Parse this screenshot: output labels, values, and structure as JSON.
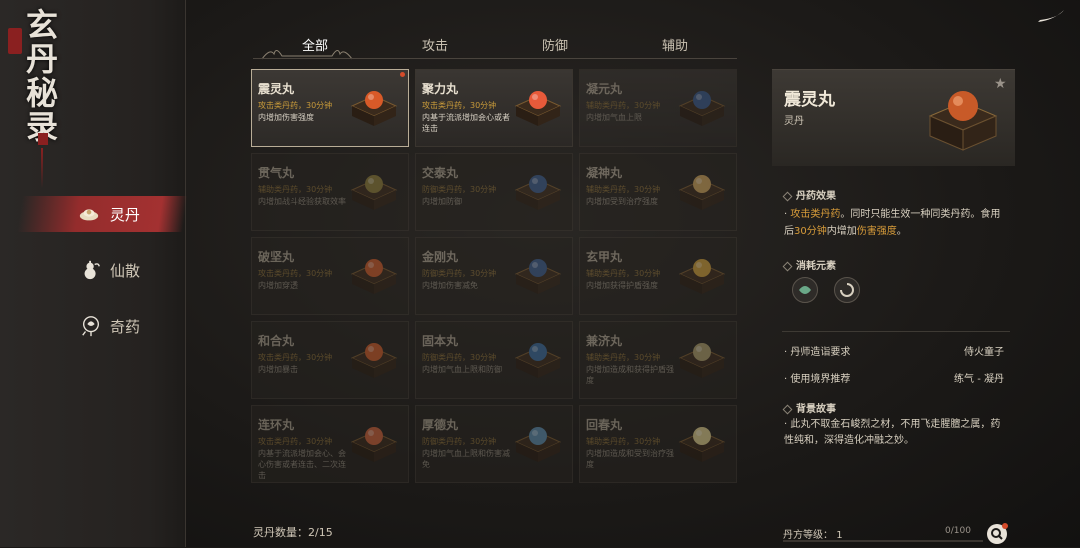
{
  "logo": {
    "chars": [
      "玄",
      "丹",
      "秘",
      "录"
    ]
  },
  "sidebar": {
    "items": [
      {
        "label": "灵丹",
        "icon": "pill-icon",
        "active": true
      },
      {
        "label": "仙散",
        "icon": "gourd-icon",
        "active": false
      },
      {
        "label": "奇药",
        "icon": "herb-icon",
        "active": false
      }
    ]
  },
  "tabs": [
    {
      "label": "全部",
      "active": true
    },
    {
      "label": "攻击",
      "active": false
    },
    {
      "label": "防御",
      "active": false
    },
    {
      "label": "辅助",
      "active": false
    }
  ],
  "pills": [
    {
      "name": "震灵丸",
      "type": "攻击类丹药，30分钟",
      "desc": "内增加伤害强度",
      "selected": true,
      "owned": true,
      "new": true,
      "color": "#d85a28"
    },
    {
      "name": "聚力丸",
      "type": "攻击类丹药，30分钟",
      "desc": "内基于流派增加会心或者连击",
      "selected": false,
      "owned": true,
      "new": false,
      "color": "#e85a3a"
    },
    {
      "name": "凝元丸",
      "type": "辅助类丹药，30分钟",
      "desc": "内增加气血上限",
      "selected": false,
      "owned": false,
      "new": false,
      "color": "#3a5a8a"
    },
    {
      "name": "贯气丸",
      "type": "辅助类丹药，30分钟",
      "desc": "内增加战斗经验获取效率",
      "selected": false,
      "owned": false,
      "new": false,
      "color": "#8a7a3a"
    },
    {
      "name": "交泰丸",
      "type": "防御类丹药，30分钟",
      "desc": "内增加防御",
      "selected": false,
      "owned": false,
      "new": false,
      "color": "#3a5a8a"
    },
    {
      "name": "凝神丸",
      "type": "辅助类丹药，30分钟",
      "desc": "内增加受到治疗强度",
      "selected": false,
      "owned": false,
      "new": false,
      "color": "#c8a05a"
    },
    {
      "name": "破坚丸",
      "type": "攻击类丹药，30分钟",
      "desc": "内增加穿透",
      "selected": false,
      "owned": false,
      "new": false,
      "color": "#c85a2a"
    },
    {
      "name": "金刚丸",
      "type": "防御类丹药，30分钟",
      "desc": "内增加伤害减免",
      "selected": false,
      "owned": false,
      "new": false,
      "color": "#3a5a8a"
    },
    {
      "name": "玄甲丸",
      "type": "辅助类丹药，30分钟",
      "desc": "内增加获得护盾强度",
      "selected": false,
      "owned": false,
      "new": false,
      "color": "#c89a3a"
    },
    {
      "name": "和合丸",
      "type": "攻击类丹药，30分钟",
      "desc": "内增加暴击",
      "selected": false,
      "owned": false,
      "new": false,
      "color": "#c85a2a"
    },
    {
      "name": "固本丸",
      "type": "防御类丹药，30分钟",
      "desc": "内增加气血上限和防御",
      "selected": false,
      "owned": false,
      "new": false,
      "color": "#3a6a9a"
    },
    {
      "name": "兼济丸",
      "type": "辅助类丹药，30分钟",
      "desc": "内增加造成和获得护盾强度",
      "selected": false,
      "owned": false,
      "new": false,
      "color": "#a89a6a"
    },
    {
      "name": "连环丸",
      "type": "攻击类丹药，30分钟",
      "desc": "内基于流派增加会心、会心伤害或者连击、二次连击",
      "selected": false,
      "owned": false,
      "new": false,
      "color": "#c8603a"
    },
    {
      "name": "厚德丸",
      "type": "防御类丹药，30分钟",
      "desc": "内增加气血上限和伤害减免",
      "selected": false,
      "owned": false,
      "new": false,
      "color": "#5a8aaa"
    },
    {
      "name": "回春丸",
      "type": "辅助类丹药，30分钟",
      "desc": "内增加造成和受到治疗强度",
      "selected": false,
      "owned": false,
      "new": false,
      "color": "#d8c88a"
    }
  ],
  "detail": {
    "name": "震灵丸",
    "category": "灵丹",
    "effect_title": "丹药效果",
    "effect_parts": [
      "攻击类丹药",
      "。同时只能生效一种同类丹药。食用后",
      "30分钟",
      "内增加",
      "伤害强度",
      "。"
    ],
    "elements_title": "消耗元素",
    "req_label": "丹师造诣要求",
    "req_value": "侍火童子",
    "realm_label": "使用境界推荐",
    "realm_value": "练气 - 凝丹",
    "story_title": "背景故事",
    "story": "此丸不取金石峻烈之材，不用飞走腥膻之属，药性纯和，深得造化冲融之妙。"
  },
  "footer": {
    "count_label": "灵丹数量：2/15",
    "level_label": "丹方等级：",
    "level_value": "1",
    "progress_text": "0/100",
    "progress_value": 0
  },
  "colors": {
    "accent": "#c89a3a",
    "active_nav": "#a83030",
    "new_dot": "#d44b2a"
  }
}
